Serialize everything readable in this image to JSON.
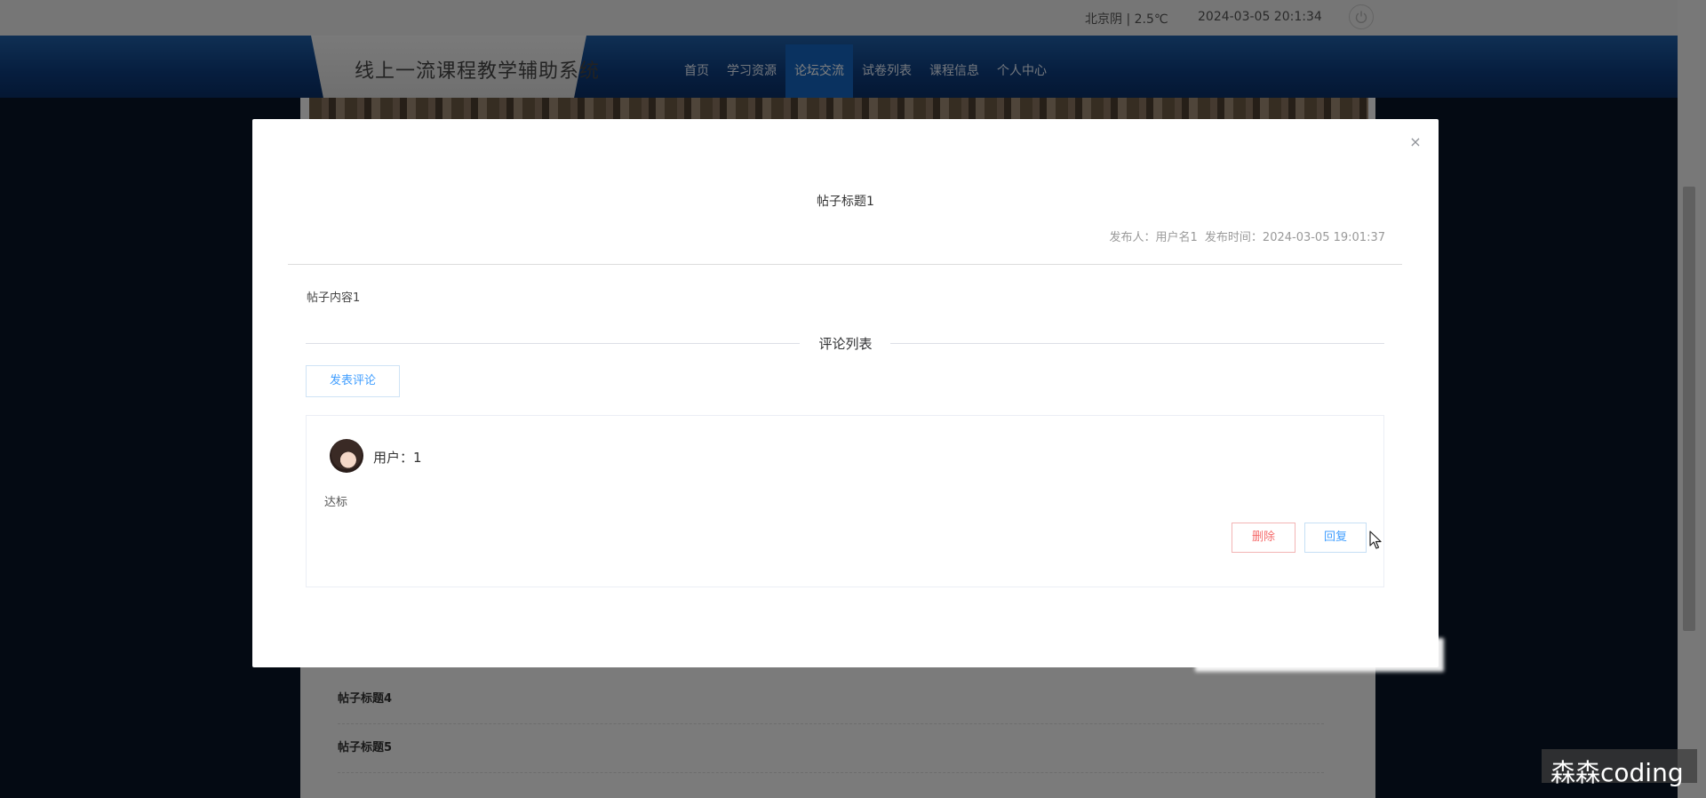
{
  "topbar": {
    "weather": "北京阴 | 2.5℃",
    "datetime": "2024-03-05  20:1:34"
  },
  "header": {
    "site_title": "线上一流课程教学辅助系统"
  },
  "nav": {
    "items": [
      {
        "label": "首页"
      },
      {
        "label": "学习资源"
      },
      {
        "label": "论坛交流",
        "active": true
      },
      {
        "label": "试卷列表"
      },
      {
        "label": "课程信息"
      },
      {
        "label": "个人中心"
      }
    ]
  },
  "background_list": {
    "posts": [
      {
        "title": "帖子标题4"
      },
      {
        "title": "帖子标题5"
      }
    ]
  },
  "modal": {
    "close_symbol": "×",
    "post_title": "帖子标题1",
    "publisher_label": "发布人：",
    "publisher": "用户名1",
    "publish_time_label": "发布时间：",
    "publish_time": "2024-03-05 19:01:37",
    "content": "帖子内容1",
    "comment_section_title": "评论列表",
    "post_comment_button": "发表评论",
    "comments": [
      {
        "user_label": "用户：1",
        "text": "达标",
        "delete_button": "删除",
        "reply_button": "回复"
      }
    ]
  },
  "watermark": {
    "text": "森森coding"
  },
  "colors": {
    "accent": "#409eff",
    "danger": "#f56c6c",
    "nav_active": "#1565c0",
    "nav_bg": "#0d3c7e"
  },
  "icons": {
    "close": "close-icon",
    "power": "power-icon",
    "avatar": "avatar",
    "cursor": "mouse-cursor-icon"
  }
}
